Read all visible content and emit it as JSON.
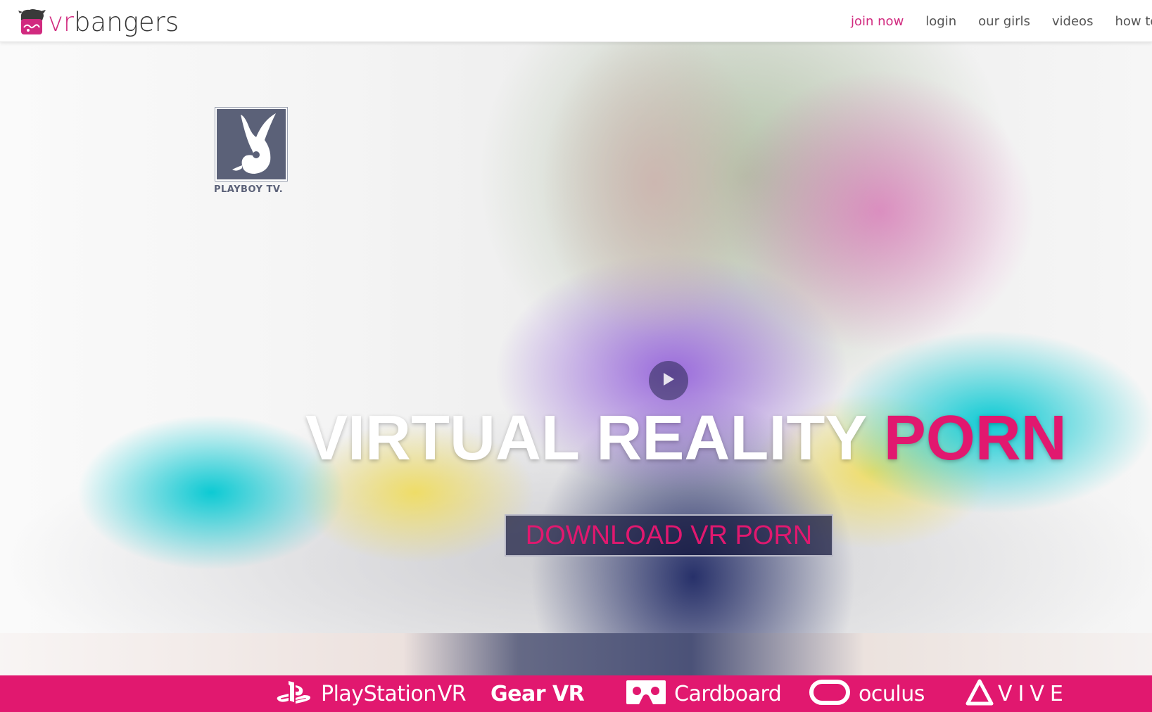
{
  "header": {
    "logo_vr": "vr",
    "logo_bangers": "bangers",
    "nav": [
      {
        "label": "join now",
        "active": true
      },
      {
        "label": "login",
        "active": false
      },
      {
        "label": "our girls",
        "active": false
      },
      {
        "label": "videos",
        "active": false
      },
      {
        "label": "how to w",
        "active": false
      }
    ]
  },
  "hero": {
    "partner_logo_text": "PLAYBOY TV.",
    "headline_white": "VIRTUAL REALITY ",
    "headline_pink": "PORN",
    "cta_label": "DOWNLOAD VR PORN",
    "play_icon": "play-icon"
  },
  "devices": [
    {
      "name": "PlayStation",
      "suffix": "VR",
      "icon": "playstation-icon"
    },
    {
      "name": "Gear VR",
      "icon": ""
    },
    {
      "name": "Cardboard",
      "icon": "cardboard-icon"
    },
    {
      "name": "oculus",
      "icon": "oculus-icon"
    },
    {
      "name": "VIVE",
      "icon": "vive-icon"
    }
  ],
  "colors": {
    "brand_pink": "#e1186f",
    "nav_active": "#d12a7f",
    "nav_text": "#555555",
    "partner_logo": "#5b6178"
  }
}
